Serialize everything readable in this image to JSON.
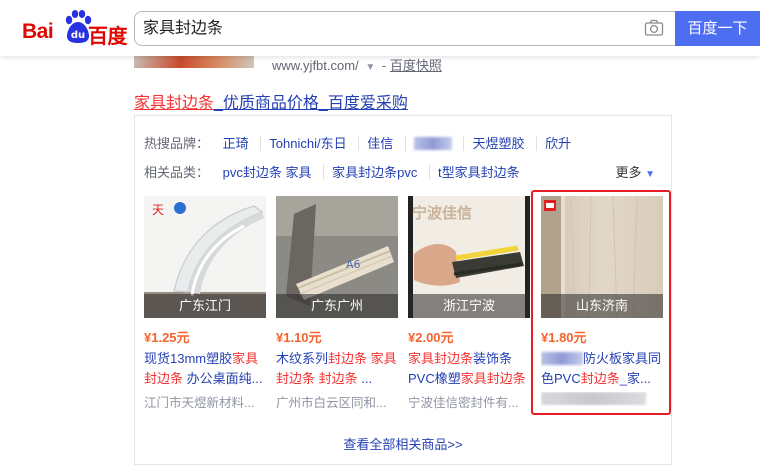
{
  "header": {
    "logo_bai": "Bai",
    "logo_du": "百度",
    "search_value": "家具封边条",
    "search_button": "百度一下",
    "camera_icon": "camera-icon"
  },
  "prev_result": {
    "url": "www.yjfbt.com/",
    "separator": "-",
    "cache": "百度快照"
  },
  "result": {
    "title_highlight": "家具封边条",
    "title_rest": "_优质商品价格_百度爱采购"
  },
  "filters": {
    "brands_label": "热搜品牌：",
    "brands": [
      "正琦",
      "Tohnichi/东日",
      "佳信",
      "天煜塑胶",
      "欣升"
    ],
    "categories_label": "相关品类：",
    "categories": [
      "pvc封边条 家具",
      "家具封边条pvc",
      "t型家具封边条"
    ],
    "more": "更多"
  },
  "products": [
    {
      "location": "广东江门",
      "price": "¥1.25元",
      "desc_parts": [
        "现货13mm塑胶",
        "家具封边条",
        " 办公桌面纯..."
      ],
      "shop": "江门市天煜新材料..."
    },
    {
      "location": "广东广州",
      "price": "¥1.10元",
      "desc_parts": [
        "木纹系列",
        "封边条 家具封边条 封边条",
        " ..."
      ],
      "shop": "广州市白云区同和..."
    },
    {
      "location": "浙江宁波",
      "price": "¥2.00元",
      "desc_parts": [
        "",
        "家具封边条",
        "装饰条PVC橡塑",
        "家具封边条"
      ],
      "shop": "宁波佳信密封件有...",
      "watermark": "宁波佳信"
    },
    {
      "location": "山东济南",
      "price": "¥1.80元",
      "desc_parts": [
        "",
        "",
        "防火板家具同色PVC",
        "封边条",
        "_家..."
      ],
      "shop": ""
    }
  ],
  "view_all": "查看全部相关商品>>",
  "colors": {
    "accent": "#4e6ef2",
    "link": "#2440b3",
    "highlight_red": "#f73131",
    "price_orange": "#f5642c",
    "box_red": "#e51c23"
  }
}
